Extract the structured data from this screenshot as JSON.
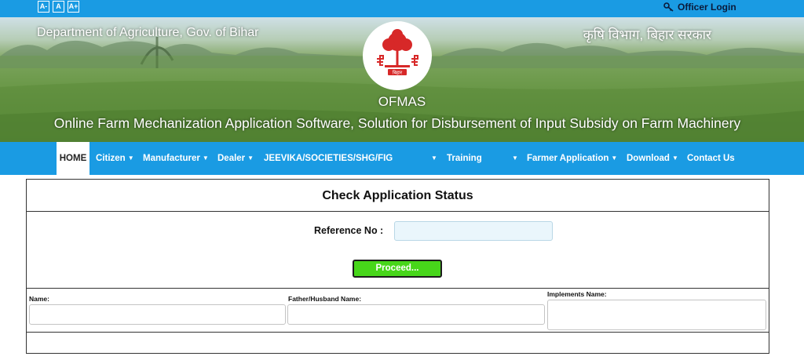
{
  "topbar": {
    "font_buttons": [
      "A-",
      "A",
      "A+"
    ],
    "officer_login": "Officer Login",
    "icon": "key-icon"
  },
  "hero": {
    "dept_en": "Department of Agriculture, Gov. of Bihar",
    "dept_hi": "कृषि विभाग, बिहार सरकार",
    "logo_text": "बिहार",
    "title": "OFMAS",
    "subtitle": "Online Farm Mechanization Application Software, Solution for Disbursement of Input Subsidy on Farm Machinery"
  },
  "nav": {
    "home": "HOME",
    "citizen": "Citizen",
    "manufacturer": "Manufacturer",
    "dealer": "Dealer",
    "jeevika": "JEEVIKA/SOCIETIES/SHG/FIG",
    "training": "Training",
    "farmer_application": "Farmer Application",
    "download": "Download",
    "contact_us": "Contact Us",
    "caret": "▼"
  },
  "form": {
    "title": "Check Application Status",
    "reference_label": "Reference No :",
    "reference_value": "",
    "proceed_label": "Proceed...",
    "name_label": "Name:",
    "father_label": "Father/Husband Name:",
    "implements_label": "Implements Name:"
  },
  "colors": {
    "primary_blue": "#1a9be3",
    "proceed_green": "#47d61a"
  }
}
